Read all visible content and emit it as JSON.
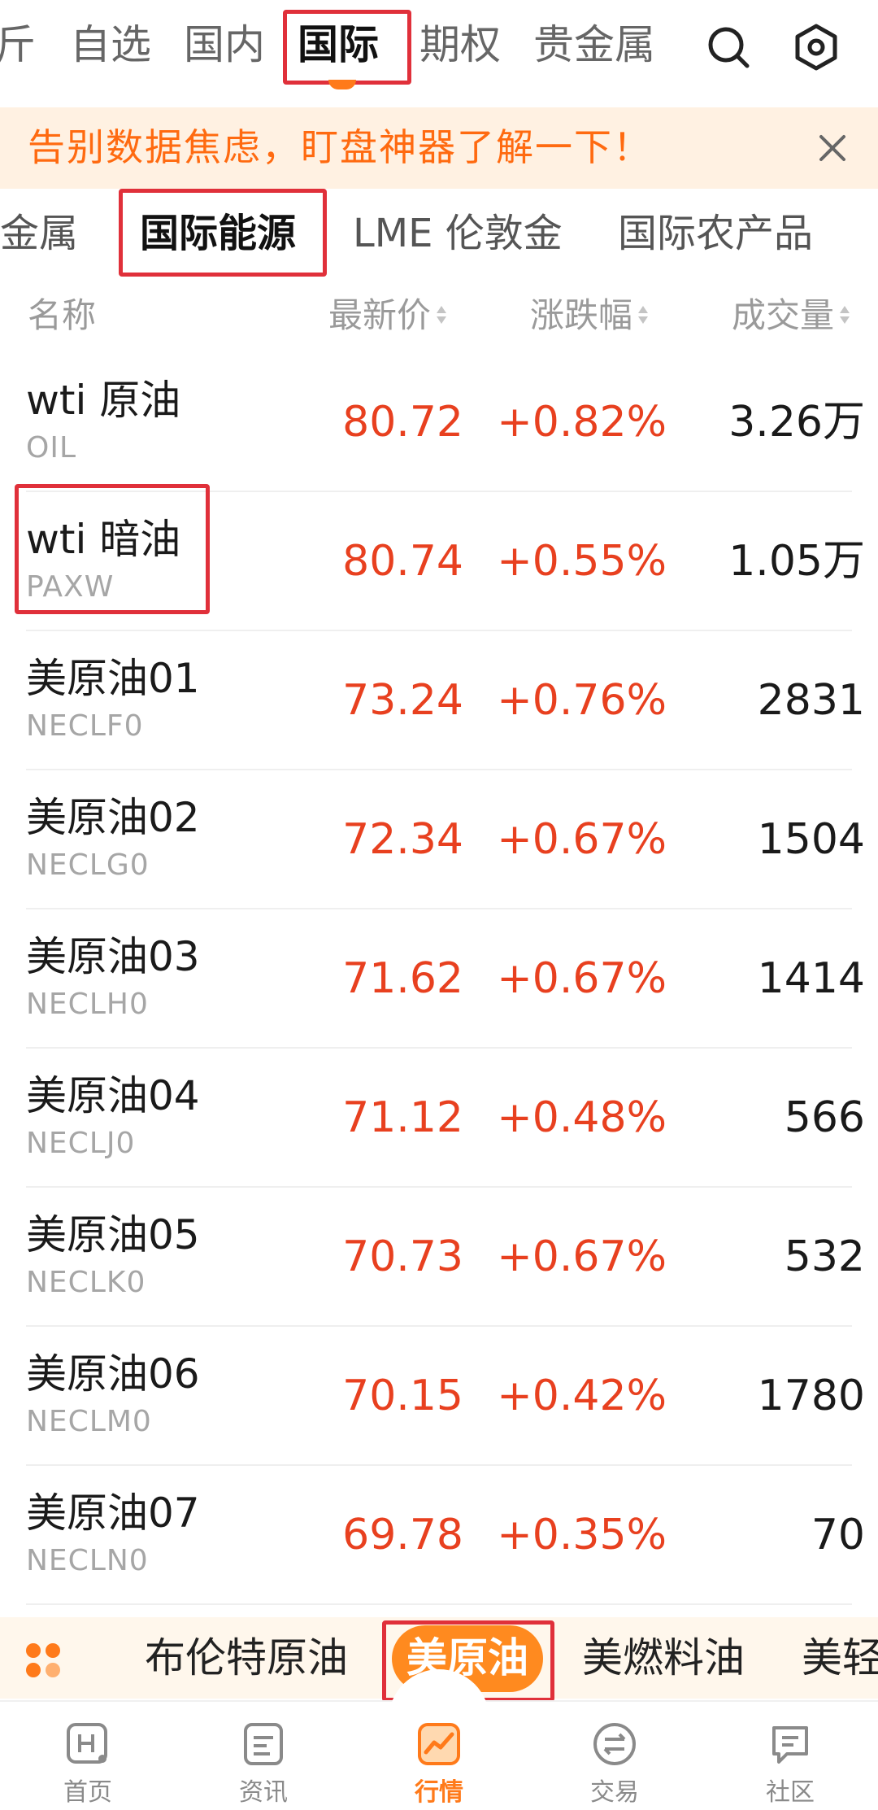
{
  "top_tabs": {
    "items": [
      {
        "label": "斤"
      },
      {
        "label": "自选"
      },
      {
        "label": "国内"
      },
      {
        "label": "国际"
      },
      {
        "label": "期权"
      },
      {
        "label": "贵金属"
      }
    ],
    "active_index": 3,
    "search_icon": "search-icon",
    "settings_icon": "settings-hexagon-icon"
  },
  "banner": {
    "text": "告别数据焦虑，盯盘神器了解一下！",
    "close_icon": "close-icon"
  },
  "sub_tabs": {
    "items": [
      {
        "label": "贵金属"
      },
      {
        "label": "国际能源"
      },
      {
        "label": "LME 伦敦金"
      },
      {
        "label": "国际农产品"
      }
    ],
    "active_index": 1
  },
  "list_header": {
    "name": "名称",
    "price": "最新价",
    "change": "涨跌幅",
    "volume": "成交量"
  },
  "rows": [
    {
      "name": "wti 原油",
      "code": "OIL",
      "price": "80.72",
      "change": "+0.82%",
      "volume": "3.26万"
    },
    {
      "name": "wti 暗油",
      "code": "PAXW",
      "price": "80.74",
      "change": "+0.55%",
      "volume": "1.05万"
    },
    {
      "name": "美原油01",
      "code": "NECLF0",
      "price": "73.24",
      "change": "+0.76%",
      "volume": "2831"
    },
    {
      "name": "美原油02",
      "code": "NECLG0",
      "price": "72.34",
      "change": "+0.67%",
      "volume": "1504"
    },
    {
      "name": "美原油03",
      "code": "NECLH0",
      "price": "71.62",
      "change": "+0.67%",
      "volume": "1414"
    },
    {
      "name": "美原油04",
      "code": "NECLJ0",
      "price": "71.12",
      "change": "+0.48%",
      "volume": "566"
    },
    {
      "name": "美原油05",
      "code": "NECLK0",
      "price": "70.73",
      "change": "+0.67%",
      "volume": "532"
    },
    {
      "name": "美原油06",
      "code": "NECLM0",
      "price": "70.15",
      "change": "+0.42%",
      "volume": "1780"
    },
    {
      "name": "美原油07",
      "code": "NECLN0",
      "price": "69.78",
      "change": "+0.35%",
      "volume": "70"
    }
  ],
  "category_strip": {
    "icon": "grid-dots-icon",
    "items": [
      {
        "label": "布伦特原油"
      },
      {
        "label": "美原油"
      },
      {
        "label": "美燃料油"
      },
      {
        "label": "美轻"
      }
    ],
    "active_index": 1
  },
  "bottom_nav": {
    "items": [
      {
        "label": "首页",
        "icon": "home-h-icon"
      },
      {
        "label": "资讯",
        "icon": "news-icon"
      },
      {
        "label": "行情",
        "icon": "market-chart-icon"
      },
      {
        "label": "交易",
        "icon": "trade-exchange-icon"
      },
      {
        "label": "社区",
        "icon": "community-chat-icon"
      }
    ],
    "active_index": 2
  },
  "colors": {
    "accent_orange": "#ff7a1a",
    "rise_red": "#e8401f",
    "highlight_box": "#e0303a",
    "banner_bg": "#fff1e2"
  }
}
